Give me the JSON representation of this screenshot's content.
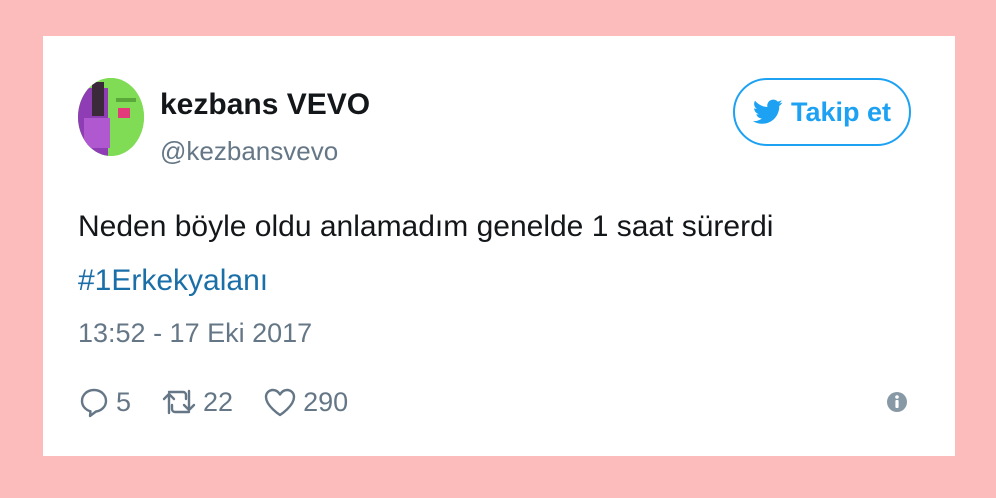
{
  "tweet": {
    "display_name": "kezbans VEVO",
    "handle": "@kezbansvevo",
    "follow_label": "Takip et",
    "text": "Neden böyle oldu anlamadım genelde 1 saat sürerdi",
    "hashtag": "#1Erkekyalanı",
    "timestamp": "13:52 - 17 Eki 2017",
    "reply_count": "5",
    "retweet_count": "22",
    "like_count": "290"
  },
  "colors": {
    "background": "#fcbcbb",
    "card": "#ffffff",
    "accent": "#1da1f2",
    "link": "#1b6fa8",
    "muted": "#657786"
  },
  "icons": [
    "twitter-bird-icon",
    "reply-icon",
    "retweet-icon",
    "like-icon",
    "info-icon"
  ]
}
